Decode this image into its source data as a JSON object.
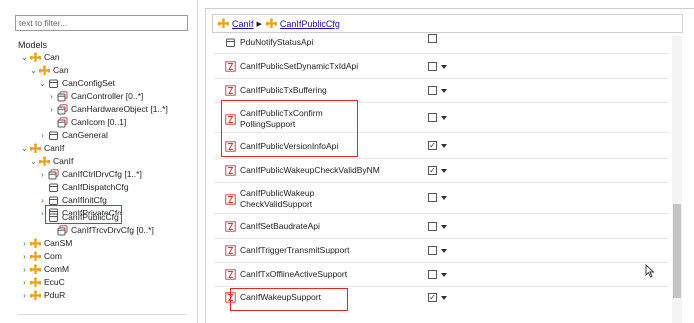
{
  "filter": {
    "placeholder": "text to filter..."
  },
  "tree": {
    "heading": "Models",
    "nodes": [
      {
        "label": "Can",
        "icon": "module-icon"
      },
      {
        "label": "Can",
        "icon": "module-icon"
      },
      {
        "label": "CanConfigSet",
        "icon": "container-icon"
      },
      {
        "label": "CanController [0..*]",
        "icon": "container-list-icon"
      },
      {
        "label": "CanHardwareObject [1..*]",
        "icon": "container-list-icon"
      },
      {
        "label": "CanIcom [0..1]",
        "icon": "container-list-icon"
      },
      {
        "label": "CanGeneral",
        "icon": "container-icon"
      },
      {
        "label": "CanIf",
        "icon": "module-icon"
      },
      {
        "label": "CanIf",
        "icon": "module-icon"
      },
      {
        "label": "CanIfCtrlDrvCfg [1..*]",
        "icon": "container-list-icon"
      },
      {
        "label": "CanIfDispatchCfg",
        "icon": "container-icon"
      },
      {
        "label": "CanIfInitCfg",
        "icon": "container-icon"
      },
      {
        "label": "CanIfPrivateCfg",
        "icon": "container-icon"
      },
      {
        "label": "CanIfPublicCfg",
        "icon": "container-icon"
      },
      {
        "label": "CanIfTrcvDrvCfg [0..*]",
        "icon": "container-list-icon"
      },
      {
        "label": "CanSM",
        "icon": "module-icon"
      },
      {
        "label": "Com",
        "icon": "module-icon"
      },
      {
        "label": "ComM",
        "icon": "module-icon"
      },
      {
        "label": "EcuC",
        "icon": "module-icon"
      },
      {
        "label": "PduR",
        "icon": "module-icon"
      }
    ]
  },
  "breadcrumb": {
    "items": [
      "CanIf",
      "CanIfPublicCfg"
    ],
    "separator": "▶"
  },
  "params": [
    {
      "label": "PduNotifyStatusApi",
      "checked": false
    },
    {
      "label": "CanIfPublicSetDynamicTxIdApi",
      "checked": false
    },
    {
      "label": "CanIfPublicTxBuffering",
      "checked": false
    },
    {
      "label": "CanIfPublicTxConfirm",
      "label2": "PollingSupport",
      "checked": false
    },
    {
      "label": "CanIfPublicVersionInfoApi",
      "checked": true
    },
    {
      "label": "CanIfPublicWakeupCheckValidByNM",
      "checked": true
    },
    {
      "label": "CanIfPublicWakeup",
      "label2": "CheckValidSupport",
      "checked": false
    },
    {
      "label": "CanIfSetBaudrateApi",
      "checked": false
    },
    {
      "label": "CanIfTriggerTransmitSupport",
      "checked": false
    },
    {
      "label": "CanIfTxOfflineActiveSupport",
      "checked": false
    },
    {
      "label": "CanIfWakeupSupport",
      "checked": true
    }
  ],
  "colors": {
    "highlight": "#e5262a",
    "link": "#1a0dab",
    "module_icon": "#e8a020"
  }
}
